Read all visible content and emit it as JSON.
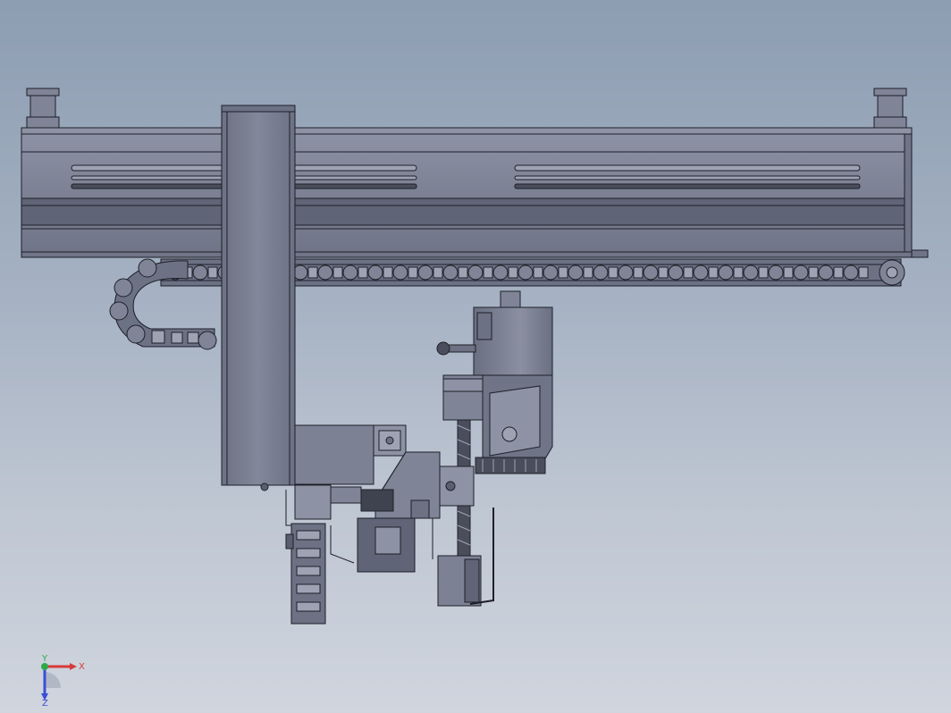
{
  "scene": {
    "kind": "CAD assembly view",
    "colors": {
      "background_top": "#8d9db2",
      "background_bottom": "#d0d5de",
      "part_fill": "#7f8497",
      "part_fill_light": "#8d92a4",
      "part_fill_dark": "#5a5f70",
      "edge": "#1d2028",
      "belt": "#3f4350"
    }
  },
  "triad": {
    "x_label": "X",
    "y_label": "Y",
    "z_label": "Z",
    "x_color": "#d63a3a",
    "y_color": "#2fa84a",
    "z_color": "#3a4fd6"
  }
}
